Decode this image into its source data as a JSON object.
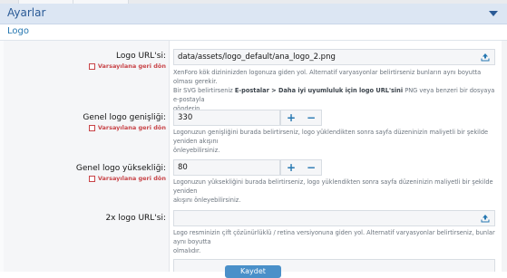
{
  "panel": {
    "title": "Ayarlar"
  },
  "section": {
    "title": "Logo"
  },
  "revert_label": "Varsayılana geri dön",
  "fields": [
    {
      "label": "Logo URL'si:",
      "value": "data/assets/logo_default/ana_logo_2.png",
      "explain_1": "XenForo kök dizininizden logonuza giden yol. Alternatif varyasyonlar belirtirseniz bunların aynı boyutta olması gerekir.",
      "explain_2a": "Bir SVG belirtirseniz ",
      "explain_2b": "E-postalar > Daha iyi uyumluluk için logo URL'sini",
      "explain_2c": " PNG veya benzeri bir dosyaya e-postayla",
      "explain_3": "gönderin."
    },
    {
      "label": "Genel logo genişliği:",
      "value": "330",
      "explain_1": "Logonuzun genişliğini burada belirtirseniz, logo yüklendikten sonra sayfa düzeninizin maliyetli bir şekilde yeniden akışını",
      "explain_2": "önleyebilirsiniz."
    },
    {
      "label": "Genel logo yüksekliği:",
      "value": "80",
      "explain_1": "Logonuzun yüksekliğini burada belirtirseniz, logo yüklendikten sonra sayfa düzeninizin maliyetli bir şekilde yeniden",
      "explain_2": "akışını önleyebilirsiniz."
    },
    {
      "label": "2x logo URL'si:",
      "value": "",
      "explain_1": "Logo resminizin çift çözünürlüklü / retina versiyonuna giden yol. Alternatif varyasyonlar belirtirseniz, bunlar aynı boyutta",
      "explain_2": "olmalıdır."
    }
  ],
  "stepper": {
    "plus": "+",
    "minus": "−"
  },
  "save_button": {
    "label": "Kaydet"
  },
  "colors": {
    "header_bg": "#dce6f3",
    "accent": "#2577b1",
    "revert": "#c84448"
  },
  "icons": {
    "upload": "upload-icon",
    "collapse": "chevron-down-icon"
  }
}
